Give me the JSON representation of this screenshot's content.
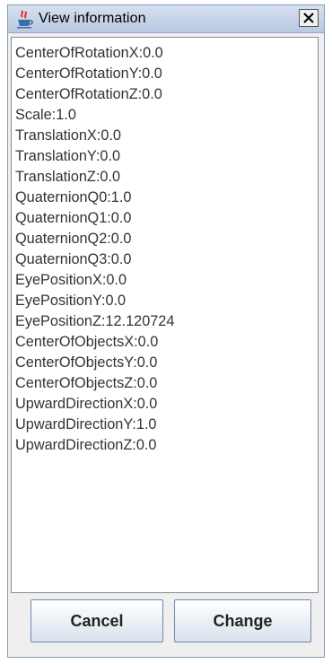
{
  "window": {
    "title": "View information",
    "icon": "java-cup-icon",
    "close_icon": "close-icon"
  },
  "properties": [
    "CenterOfRotationX:0.0",
    "CenterOfRotationY:0.0",
    "CenterOfRotationZ:0.0",
    "Scale:1.0",
    "TranslationX:0.0",
    "TranslationY:0.0",
    "TranslationZ:0.0",
    "QuaternionQ0:1.0",
    "QuaternionQ1:0.0",
    "QuaternionQ2:0.0",
    "QuaternionQ3:0.0",
    "EyePositionX:0.0",
    "EyePositionY:0.0",
    "EyePositionZ:12.120724",
    "CenterOfObjectsX:0.0",
    "CenterOfObjectsY:0.0",
    "CenterOfObjectsZ:0.0",
    "UpwardDirectionX:0.0",
    "UpwardDirectionY:1.0",
    "UpwardDirectionZ:0.0"
  ],
  "buttons": {
    "cancel_label": "Cancel",
    "change_label": "Change"
  }
}
